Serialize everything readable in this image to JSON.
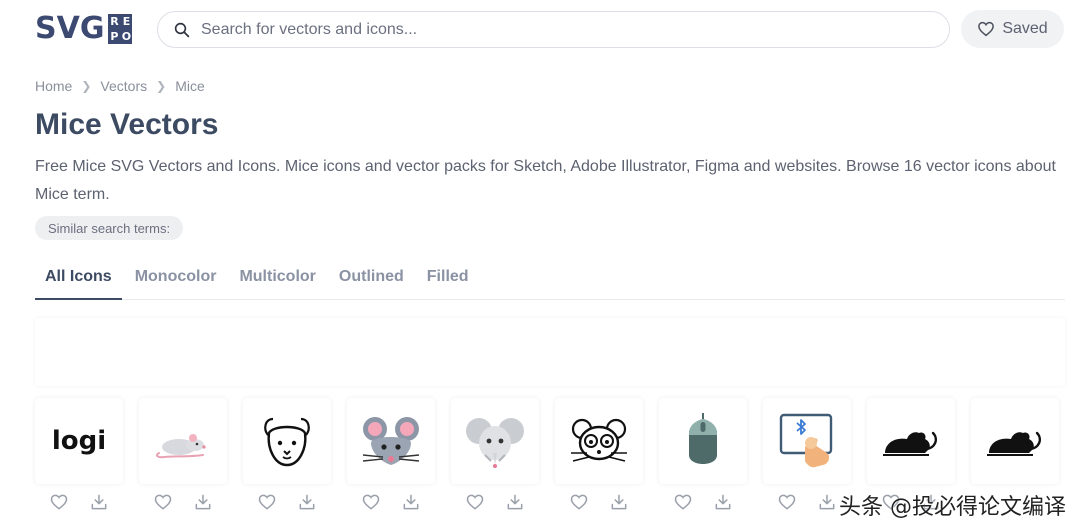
{
  "header": {
    "logo": {
      "text": "SVG",
      "box_letters": [
        "R",
        "E",
        "P",
        "O"
      ]
    },
    "search": {
      "placeholder": "Search for vectors and icons...",
      "value": ""
    },
    "saved_label": "Saved"
  },
  "breadcrumb": [
    "Home",
    "Vectors",
    "Mice"
  ],
  "page": {
    "title": "Mice Vectors",
    "description": "Free Mice SVG Vectors and Icons. Mice icons and vector packs for Sketch, Adobe Illustrator, Figma and websites. Browse 16 vector icons about Mice term.",
    "similar_terms_label": "Similar search terms:"
  },
  "tabs": [
    {
      "label": "All Icons",
      "active": true
    },
    {
      "label": "Monocolor",
      "active": false
    },
    {
      "label": "Multicolor",
      "active": false
    },
    {
      "label": "Outlined",
      "active": false
    },
    {
      "label": "Filled",
      "active": false
    }
  ],
  "icons": [
    {
      "name": "logi-logo-icon",
      "logo_text": "logi"
    },
    {
      "name": "rat-pink-icon"
    },
    {
      "name": "hamster-outline-icon"
    },
    {
      "name": "mouse-face-gray-icon"
    },
    {
      "name": "elephant-mouse-face-icon"
    },
    {
      "name": "mouse-face-outline-icon"
    },
    {
      "name": "computer-mouse-icon"
    },
    {
      "name": "bluetooth-mouse-tap-icon"
    },
    {
      "name": "mouse-silhouette-icon"
    },
    {
      "name": "mouse-silhouette-icon"
    }
  ],
  "watermark": "头条 @投必得论文编译",
  "colors": {
    "brand": "#3c4a72",
    "title": "#3c4a62",
    "muted": "#8a92a3"
  }
}
